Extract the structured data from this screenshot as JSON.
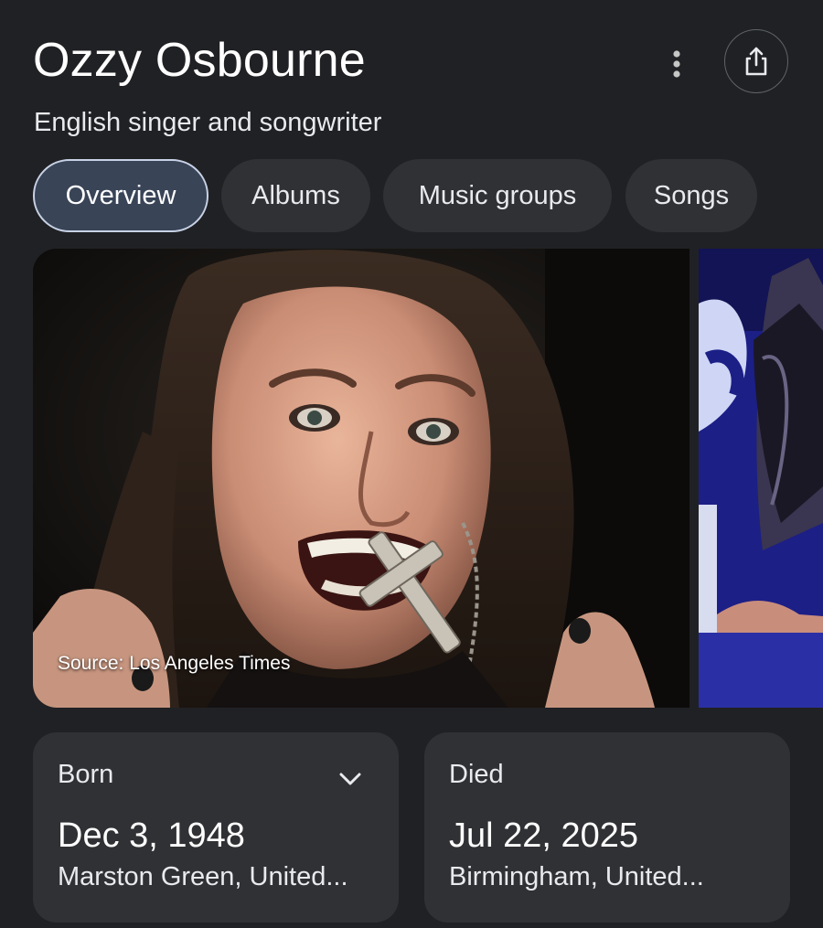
{
  "header": {
    "title": "Ozzy Osbourne",
    "subtitle": "English singer and songwriter",
    "more_icon": "more-vert-icon",
    "share_icon": "share-icon"
  },
  "tabs": [
    {
      "label": "Overview",
      "active": true
    },
    {
      "label": "Albums",
      "active": false
    },
    {
      "label": "Music groups",
      "active": false
    },
    {
      "label": "Songs",
      "active": false
    }
  ],
  "gallery": {
    "main_source": "Source: Los Angeles Times"
  },
  "facts": {
    "born": {
      "label": "Born",
      "date": "Dec 3, 1948",
      "place": "Marston Green, United...",
      "expand_icon": "chevron-down-icon"
    },
    "died": {
      "label": "Died",
      "date": "Jul 22, 2025",
      "place": "Birmingham, United..."
    }
  },
  "colors": {
    "background": "#202124",
    "chip": "#303134",
    "chip_active": "#394457",
    "chip_active_border": "#c8d2e6"
  }
}
